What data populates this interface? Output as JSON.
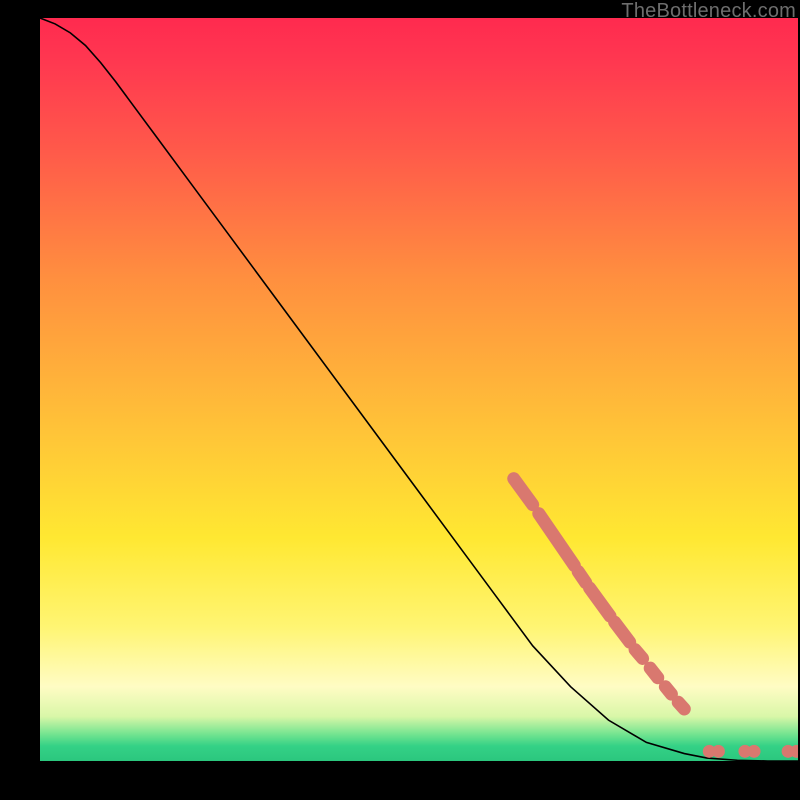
{
  "watermark": "TheBottleneck.com",
  "colors": {
    "curve_stroke": "#000000",
    "marker_fill": "#d9786f",
    "marker_stroke": "#c76b63"
  },
  "chart_data": {
    "type": "line",
    "title": "",
    "xlabel": "",
    "ylabel": "",
    "xlim": [
      0,
      100
    ],
    "ylim": [
      0,
      100
    ],
    "curve": [
      {
        "x": 0,
        "y": 100.0
      },
      {
        "x": 2,
        "y": 99.2
      },
      {
        "x": 4,
        "y": 98.0
      },
      {
        "x": 6,
        "y": 96.3
      },
      {
        "x": 8,
        "y": 94.0
      },
      {
        "x": 10,
        "y": 91.4
      },
      {
        "x": 15,
        "y": 84.5
      },
      {
        "x": 20,
        "y": 77.6
      },
      {
        "x": 25,
        "y": 70.7
      },
      {
        "x": 30,
        "y": 63.8
      },
      {
        "x": 35,
        "y": 56.9
      },
      {
        "x": 40,
        "y": 50.0
      },
      {
        "x": 45,
        "y": 43.1
      },
      {
        "x": 50,
        "y": 36.2
      },
      {
        "x": 55,
        "y": 29.3
      },
      {
        "x": 60,
        "y": 22.4
      },
      {
        "x": 65,
        "y": 15.5
      },
      {
        "x": 70,
        "y": 10.0
      },
      {
        "x": 75,
        "y": 5.5
      },
      {
        "x": 80,
        "y": 2.5
      },
      {
        "x": 85,
        "y": 1.0
      },
      {
        "x": 88,
        "y": 0.4
      },
      {
        "x": 92,
        "y": 0.1
      },
      {
        "x": 96,
        "y": 0.0
      },
      {
        "x": 100,
        "y": 0.0
      }
    ],
    "marker_segments": [
      {
        "x0": 62.5,
        "y0": 38.0,
        "x1": 65.0,
        "y1": 34.5
      },
      {
        "x0": 65.8,
        "y0": 33.3,
        "x1": 70.5,
        "y1": 26.3
      },
      {
        "x0": 71.0,
        "y0": 25.5,
        "x1": 72.0,
        "y1": 24.0
      },
      {
        "x0": 72.5,
        "y0": 23.3,
        "x1": 75.2,
        "y1": 19.5
      },
      {
        "x0": 75.8,
        "y0": 18.7,
        "x1": 77.8,
        "y1": 16.0
      },
      {
        "x0": 78.5,
        "y0": 15.0,
        "x1": 79.5,
        "y1": 13.8
      },
      {
        "x0": 80.5,
        "y0": 12.5,
        "x1": 81.5,
        "y1": 11.2
      },
      {
        "x0": 82.5,
        "y0": 10.0,
        "x1": 83.3,
        "y1": 9.0
      },
      {
        "x0": 84.2,
        "y0": 7.9,
        "x1": 85.0,
        "y1": 7.0
      }
    ],
    "marker_points": [
      {
        "x": 88.3,
        "y": 1.3
      },
      {
        "x": 89.5,
        "y": 1.3
      },
      {
        "x": 93.0,
        "y": 1.3
      },
      {
        "x": 94.2,
        "y": 1.3
      },
      {
        "x": 98.7,
        "y": 1.3
      },
      {
        "x": 99.8,
        "y": 1.3
      }
    ]
  }
}
